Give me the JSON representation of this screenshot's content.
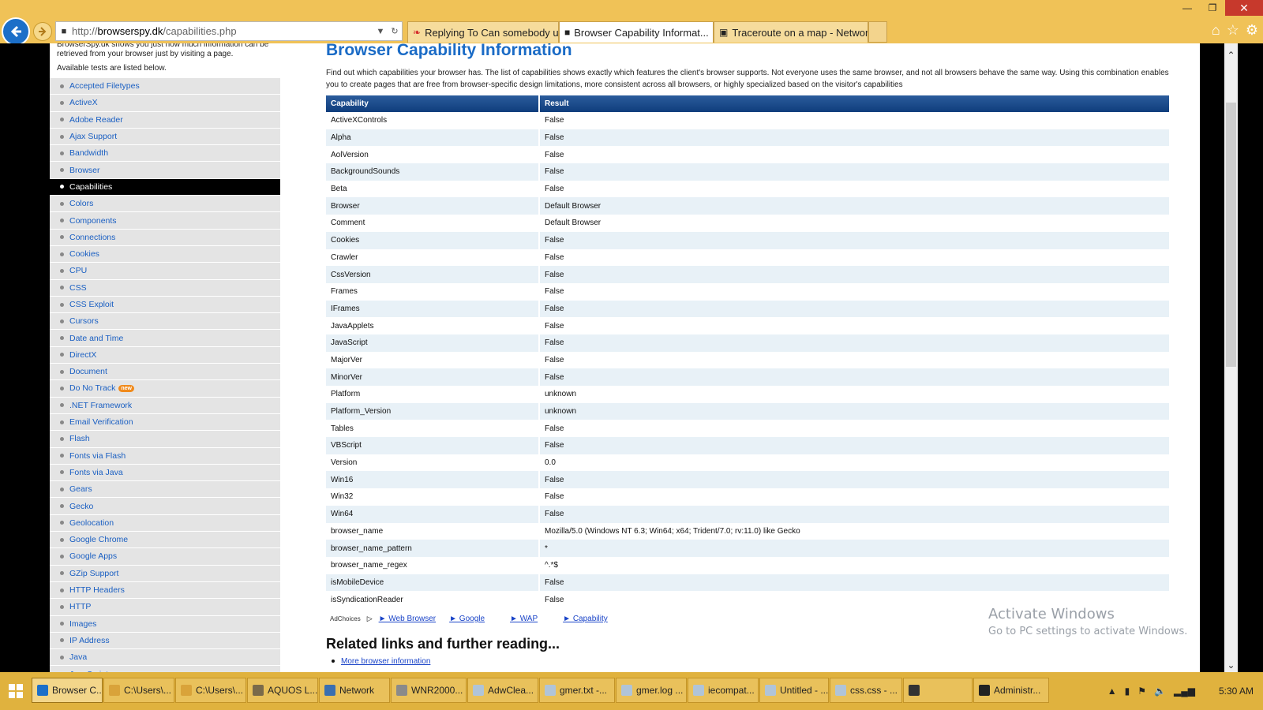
{
  "browser": {
    "address": {
      "prefix": "http://",
      "domain": "browserspy.dk",
      "path": "/capabilities.php"
    },
    "tabs": [
      {
        "label": "Replying To Can somebody un...",
        "icon": "s-logo-icon",
        "active": false
      },
      {
        "label": "Browser Capability Informat...",
        "icon": "lock-icon",
        "active": true
      },
      {
        "label": "Traceroute on a map - Networ...",
        "icon": "terminal-icon",
        "active": false
      }
    ]
  },
  "sidebar": {
    "intro": "BrowserSpy.dk shows you just how much information can be retrieved from your browser just by visiting a page.",
    "available": "Available tests are listed below.",
    "items": [
      "Accepted Filetypes",
      "ActiveX",
      "Adobe Reader",
      "Ajax Support",
      "Bandwidth",
      "Browser",
      "Capabilities",
      "Colors",
      "Components",
      "Connections",
      "Cookies",
      "CPU",
      "CSS",
      "CSS Exploit",
      "Cursors",
      "Date and Time",
      "DirectX",
      "Document",
      "Do No Track",
      ".NET Framework",
      "Email Verification",
      "Flash",
      "Fonts via Flash",
      "Fonts via Java",
      "Gears",
      "Gecko",
      "Geolocation",
      "Google Chrome",
      "Google Apps",
      "GZip Support",
      "HTTP Headers",
      "HTTP",
      "Images",
      "IP Address",
      "Java",
      "JavaScript"
    ],
    "active_index": 6,
    "new_badge_index": 18,
    "new_badge": "new"
  },
  "main": {
    "title": "Browser Capability Information",
    "description": "Find out which capabilities your browser has. The list of capabilities shows exactly which features the client's browser supports. Not everyone uses the same browser, and not all browsers behave the same way. Using this combination enables you to create pages that are free from browser-specific design limitations, more consistent across all browsers, or highly specialized based on the visitor's capabilities",
    "table": {
      "headers": [
        "Capability",
        "Result"
      ],
      "rows": [
        [
          "ActiveXControls",
          "False"
        ],
        [
          "Alpha",
          "False"
        ],
        [
          "AolVersion",
          "False"
        ],
        [
          "BackgroundSounds",
          "False"
        ],
        [
          "Beta",
          "False"
        ],
        [
          "Browser",
          "Default Browser"
        ],
        [
          "Comment",
          "Default Browser"
        ],
        [
          "Cookies",
          "False"
        ],
        [
          "Crawler",
          "False"
        ],
        [
          "CssVersion",
          "False"
        ],
        [
          "Frames",
          "False"
        ],
        [
          "IFrames",
          "False"
        ],
        [
          "JavaApplets",
          "False"
        ],
        [
          "JavaScript",
          "False"
        ],
        [
          "MajorVer",
          "False"
        ],
        [
          "MinorVer",
          "False"
        ],
        [
          "Platform",
          "unknown"
        ],
        [
          "Platform_Version",
          "unknown"
        ],
        [
          "Tables",
          "False"
        ],
        [
          "VBScript",
          "False"
        ],
        [
          "Version",
          "0.0"
        ],
        [
          "Win16",
          "False"
        ],
        [
          "Win32",
          "False"
        ],
        [
          "Win64",
          "False"
        ],
        [
          "browser_name",
          "Mozilla/5.0 (Windows NT 6.3; Win64; x64; Trident/7.0; rv:11.0) like Gecko"
        ],
        [
          "browser_name_pattern",
          "*"
        ],
        [
          "browser_name_regex",
          "^.*$"
        ],
        [
          "isMobileDevice",
          "False"
        ],
        [
          "isSyndicationReader",
          "False"
        ]
      ]
    },
    "ads": {
      "adchoices": "AdChoices",
      "links": [
        "► Web Browser",
        "► Google",
        "► WAP",
        "► Capability"
      ]
    },
    "related_heading": "Related links and further reading...",
    "related_links": [
      "More browser information"
    ]
  },
  "watermark": {
    "line1": "Activate Windows",
    "line2": "Go to PC settings to activate Windows."
  },
  "taskbar": {
    "tasks": [
      {
        "label": "Browser C...",
        "active": true,
        "color": "#1c6fc8"
      },
      {
        "label": "C:\\Users\\...",
        "active": false,
        "color": "#d9a33a"
      },
      {
        "label": "C:\\Users\\...",
        "active": false,
        "color": "#d9a33a"
      },
      {
        "label": "AQUOS L...",
        "active": false,
        "color": "#7a6a4a"
      },
      {
        "label": "Network",
        "active": false,
        "color": "#3a6fb0"
      },
      {
        "label": "WNR2000...",
        "active": false,
        "color": "#8a8a8a"
      },
      {
        "label": "AdwClea...",
        "active": false,
        "color": "#b0c4d8"
      },
      {
        "label": "gmer.txt -...",
        "active": false,
        "color": "#b0c4d8"
      },
      {
        "label": "gmer.log ...",
        "active": false,
        "color": "#b0c4d8"
      },
      {
        "label": "iecompat...",
        "active": false,
        "color": "#b0c4d8"
      },
      {
        "label": "Untitled - ...",
        "active": false,
        "color": "#b0c4d8"
      },
      {
        "label": "css.css - ...",
        "active": false,
        "color": "#b0c4d8"
      },
      {
        "label": "",
        "active": false,
        "color": "#333333"
      },
      {
        "label": "Administr...",
        "active": false,
        "color": "#222222"
      }
    ],
    "clock": "5:30 AM"
  }
}
